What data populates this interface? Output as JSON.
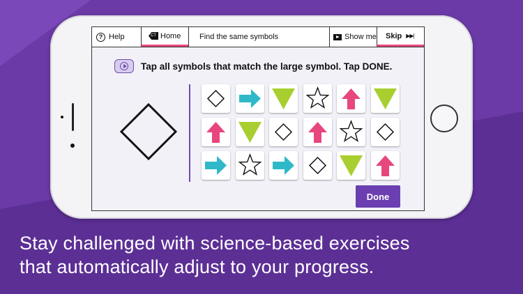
{
  "colors": {
    "background": "#6b3aa6",
    "accent_pink": "#e8467e",
    "cyan": "#2fb9c8",
    "lime": "#a8cf2f",
    "done_button": "#6b3fb1"
  },
  "topbar": {
    "help_label": "Help",
    "home_label": "Home",
    "title": "Find the same symbols",
    "show_me_label": "Show me",
    "skip_label": "Skip",
    "skip_arrows": "▶▶|"
  },
  "instruction": "Tap all symbols that match the large symbol. Tap DONE.",
  "target_symbol": "diamond",
  "grid": [
    [
      "diamond",
      "arrow-right",
      "triangle-down",
      "star",
      "arrow-up",
      "triangle-down"
    ],
    [
      "arrow-up",
      "triangle-down",
      "diamond",
      "arrow-up",
      "star",
      "diamond"
    ],
    [
      "arrow-right",
      "star",
      "arrow-right",
      "diamond",
      "triangle-down",
      "arrow-up"
    ]
  ],
  "done_label": "Done",
  "caption": [
    "Stay challenged with science-based exercises",
    "that automatically adjust to your progress."
  ]
}
